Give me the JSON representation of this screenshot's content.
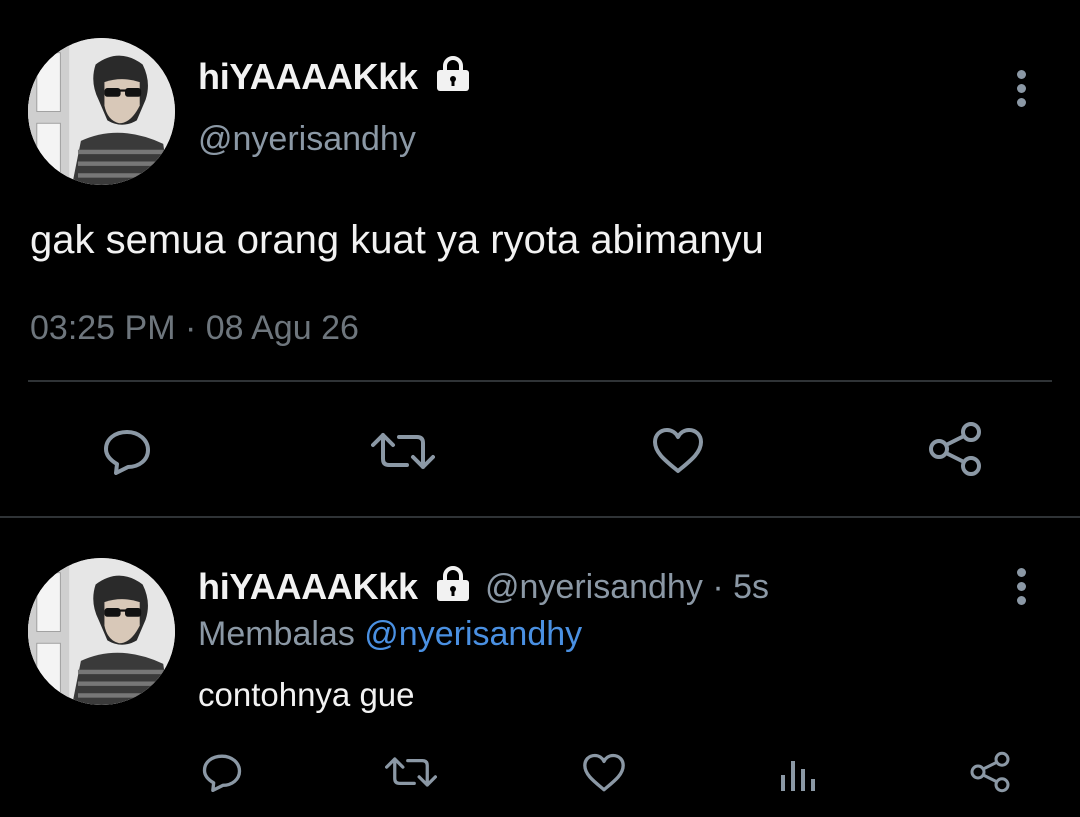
{
  "main_tweet": {
    "display_name": "hiYAAAAKkk",
    "handle": "@nyerisandhy",
    "text": "gak semua orang kuat ya ryota abimanyu",
    "timestamp": "03:25 PM · 08 Agu 26",
    "protected": true
  },
  "reply": {
    "display_name": "hiYAAAAKkk",
    "handle": "@nyerisandhy",
    "separator": "·",
    "age": "5s",
    "replying_to_label": "Membalas",
    "replying_to_handle": "@nyerisandhy",
    "text": "contohnya gue",
    "protected": true
  },
  "icons": {
    "reply": "comment-icon",
    "retweet": "retweet-icon",
    "like": "heart-icon",
    "share": "share-icon",
    "analytics": "analytics-icon",
    "more": "more-vertical-icon",
    "lock": "lock-icon"
  },
  "colors": {
    "background": "#000000",
    "text": "#f2f2f2",
    "secondary": "#8b98a5",
    "mention": "#4a90e2",
    "divider": "#2f3336"
  }
}
